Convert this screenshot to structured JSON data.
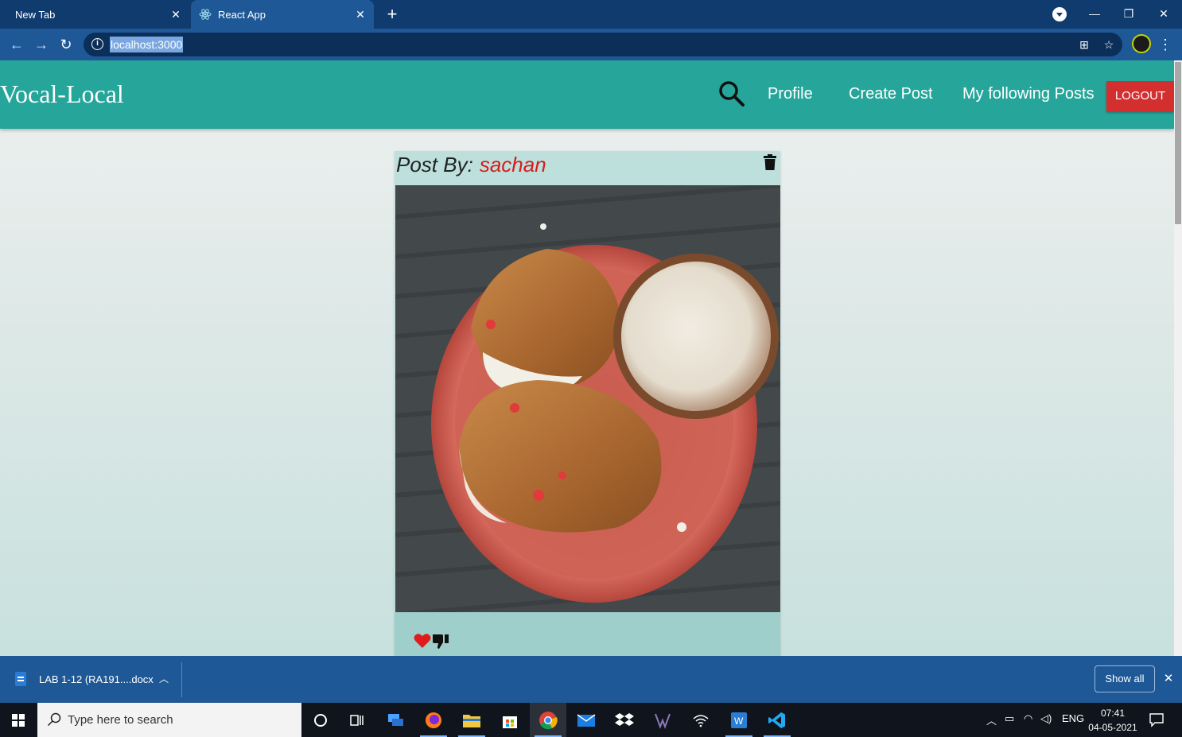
{
  "browser": {
    "tabs": [
      {
        "title": "New Tab",
        "active": false
      },
      {
        "title": "React App",
        "active": true
      }
    ],
    "url": "localhost:3000"
  },
  "app": {
    "brand": "Vocal-Local",
    "nav": {
      "links": [
        "Profile",
        "Create Post",
        "My following Posts"
      ],
      "logout_label": "LOGOUT"
    },
    "post": {
      "header_label": "Post By:",
      "author": "sachan",
      "image_subject": "bread buns with cup of tea on plate"
    }
  },
  "download_bar": {
    "file_name": "LAB 1-12 (RA191....docx",
    "show_all_label": "Show all"
  },
  "taskbar": {
    "search_placeholder": "Type here to search",
    "language": "ENG",
    "time": "07:41",
    "date": "04-05-2021"
  },
  "colors": {
    "navbar": "#26a69a",
    "logout": "#d32f2f",
    "author": "#d81b1b",
    "chrome": "#1e5896"
  }
}
